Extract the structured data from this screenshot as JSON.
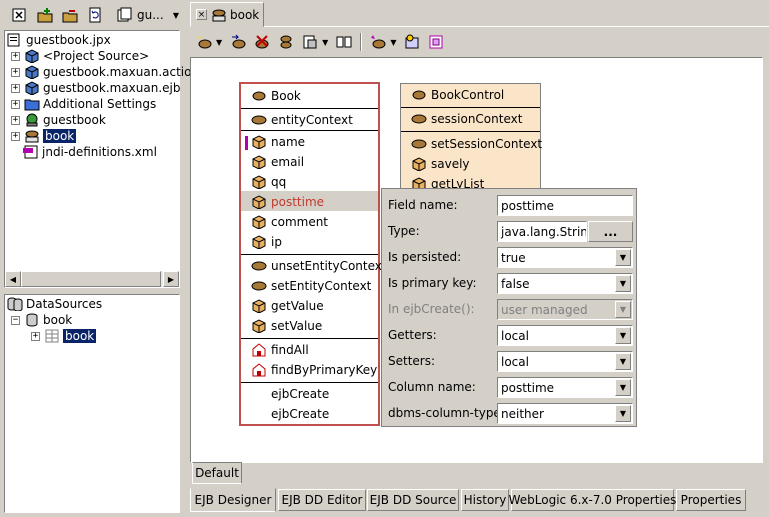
{
  "left_toolbar": {
    "combo_value": "gu..."
  },
  "project_tree": {
    "items": [
      {
        "label": "guestbook.jpx",
        "icon": "project-file-icon"
      },
      {
        "label": "<Project Source>",
        "icon": "package-icon"
      },
      {
        "label": "guestbook.maxuan.actio",
        "icon": "package-icon"
      },
      {
        "label": "guestbook.maxuan.ejb",
        "icon": "package-icon"
      },
      {
        "label": "Additional Settings",
        "icon": "folder-icon"
      },
      {
        "label": "guestbook",
        "icon": "web-app-icon"
      },
      {
        "label": "book",
        "icon": "ejb-module-icon"
      },
      {
        "label": "jndi-definitions.xml",
        "icon": "xml-file-icon"
      }
    ]
  },
  "datasources": {
    "root": "DataSources",
    "child": "book",
    "table": "book"
  },
  "editor": {
    "tab_label": "book",
    "entity": {
      "title": "Book",
      "context_method": "entityContext",
      "fields": [
        "name",
        "email",
        "qq",
        "posttime",
        "comment",
        "ip"
      ],
      "selected_field": "posttime",
      "methods": [
        "unsetEntityContext",
        "setEntityContext",
        "getValue",
        "setValue"
      ],
      "finders": [
        "findAll",
        "findByPrimaryKey"
      ],
      "creators": [
        "ejbCreate",
        "ejbCreate"
      ]
    },
    "session": {
      "title": "BookControl",
      "context_field": "sessionContext",
      "methods": [
        "setSessionContext",
        "savely",
        "getLyList"
      ]
    },
    "inspector": {
      "field_name_label": "Field name:",
      "field_name_value": "posttime",
      "type_label": "Type:",
      "type_value": "java.lang.String",
      "type_button": "...",
      "persisted_label": "Is persisted:",
      "persisted_value": "true",
      "primary_key_label": "Is primary key:",
      "primary_key_value": "false",
      "in_ejbcreate_label": "In ejbCreate():",
      "in_ejbcreate_value": "user managed",
      "getters_label": "Getters:",
      "getters_value": "local",
      "setters_label": "Setters:",
      "setters_value": "local",
      "column_name_label": "Column name:",
      "column_name_value": "posttime",
      "dbms_type_label": "dbms-column-type:",
      "dbms_type_value": "neither"
    }
  },
  "view_tab": "Default",
  "bottom_tabs": [
    "EJB Designer",
    "EJB DD Editor",
    "EJB DD Source",
    "History",
    "WebLogic 6.x-7.0 Properties",
    "Properties"
  ],
  "colors": {
    "selection": "#0a246a",
    "entity_border": "#c0504d",
    "session_bg": "#fbe5c8",
    "selected_field_text": "#c0392b"
  }
}
